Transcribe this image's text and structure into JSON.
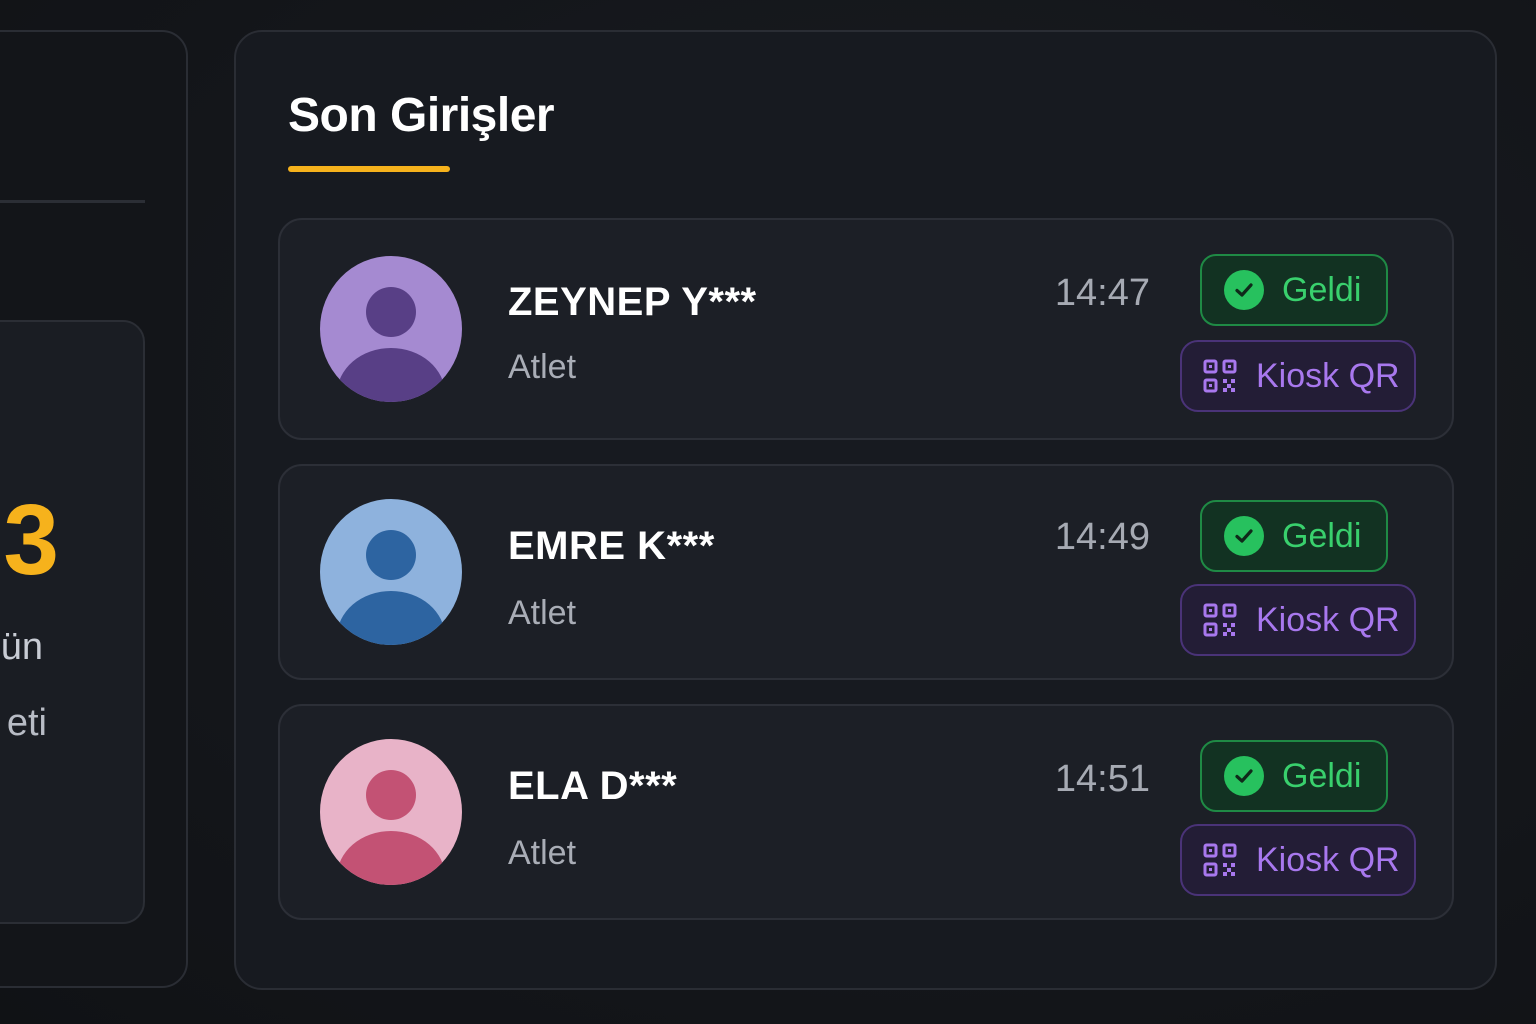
{
  "left_panel": {
    "big_number": "3",
    "line1": "ün",
    "line2": "eti"
  },
  "main": {
    "title": "Son Girişler",
    "accent_color": "#f6b21c",
    "entries": [
      {
        "name": "ZEYNEP Y***",
        "role": "Atlet",
        "time": "14:47",
        "status": "Geldi",
        "action": "Kiosk QR",
        "avatar_icon": "user-avatar-icon",
        "avatar_bg": "#a58ad1",
        "avatar_fg": "#583f86"
      },
      {
        "name": "EMRE K***",
        "role": "Atlet",
        "time": "14:49",
        "status": "Geldi",
        "action": "Kiosk QR",
        "avatar_icon": "user-avatar-icon",
        "avatar_bg": "#8eb2dd",
        "avatar_fg": "#2d64a1"
      },
      {
        "name": "ELA D***",
        "role": "Atlet",
        "time": "14:51",
        "status": "Geldi",
        "action": "Kiosk QR",
        "avatar_icon": "user-avatar-icon",
        "avatar_bg": "#e8b3c8",
        "avatar_fg": "#c35274"
      }
    ],
    "status_color": "#39d06d",
    "action_color": "#a878ee",
    "icons": {
      "status": "check-circle-icon",
      "action": "qr-code-icon"
    }
  }
}
